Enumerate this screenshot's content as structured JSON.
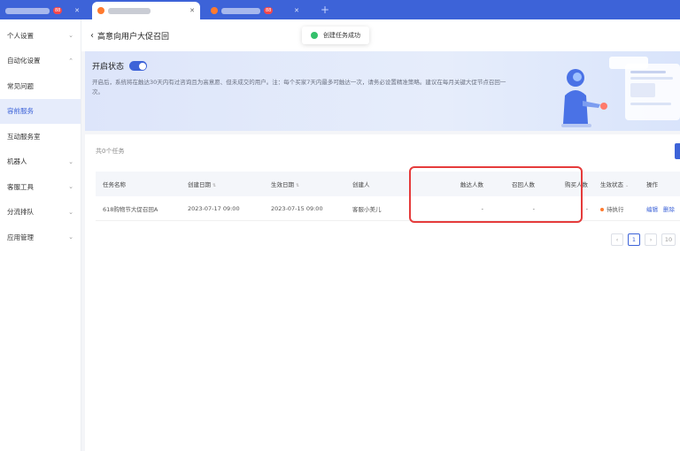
{
  "tabs": [
    {
      "badge": "88"
    },
    {},
    {
      "badge": "88"
    }
  ],
  "sidebar": {
    "items": [
      {
        "label": "个人设置"
      },
      {
        "label": "自动化设置"
      },
      {
        "label": "常见问题"
      },
      {
        "label": "容前服务"
      },
      {
        "label": "互动服务室"
      },
      {
        "label": "机器人"
      },
      {
        "label": "客服工具"
      },
      {
        "label": "分流排队"
      },
      {
        "label": "应用管理"
      }
    ],
    "active_index": 3
  },
  "header": {
    "back_icon": "‹",
    "title": "高意向用户大促召回"
  },
  "toast": {
    "text": "创建任务成功"
  },
  "banner": {
    "status_label": "开启状态",
    "toggle_on": true,
    "description": "开启后，系统将在触达30天内有过咨询且为高意愿、但未成交的用户。注：每个买家7天内最多可触达一次，请务必设置精准策略。建议在每月关键大促节点召回一次。"
  },
  "content": {
    "count_text": "共0个任务"
  },
  "table": {
    "headers": [
      "任务名称",
      "创建日期",
      "生效日期",
      "创建人",
      "触达人数",
      "召回人数",
      "购买人数",
      "生效状态",
      "操作"
    ],
    "rows": [
      {
        "name": "618购物节大促召回A",
        "created": "2023-07-17 09:00",
        "effective": "2023-07-15 09:00",
        "creator": "客服小美儿",
        "reached": "-",
        "recalled": "-",
        "purchased": "-",
        "status": "待执行",
        "op_edit": "编辑",
        "op_delete": "删除"
      }
    ]
  },
  "pager": {
    "prev": "‹",
    "page": "1",
    "next": "›",
    "size_label": "10"
  },
  "colors": {
    "brand": "#3d63d8",
    "highlight": "#e53b3b",
    "status_pending": "#ff7a2e",
    "toast_success": "#34c06b"
  }
}
